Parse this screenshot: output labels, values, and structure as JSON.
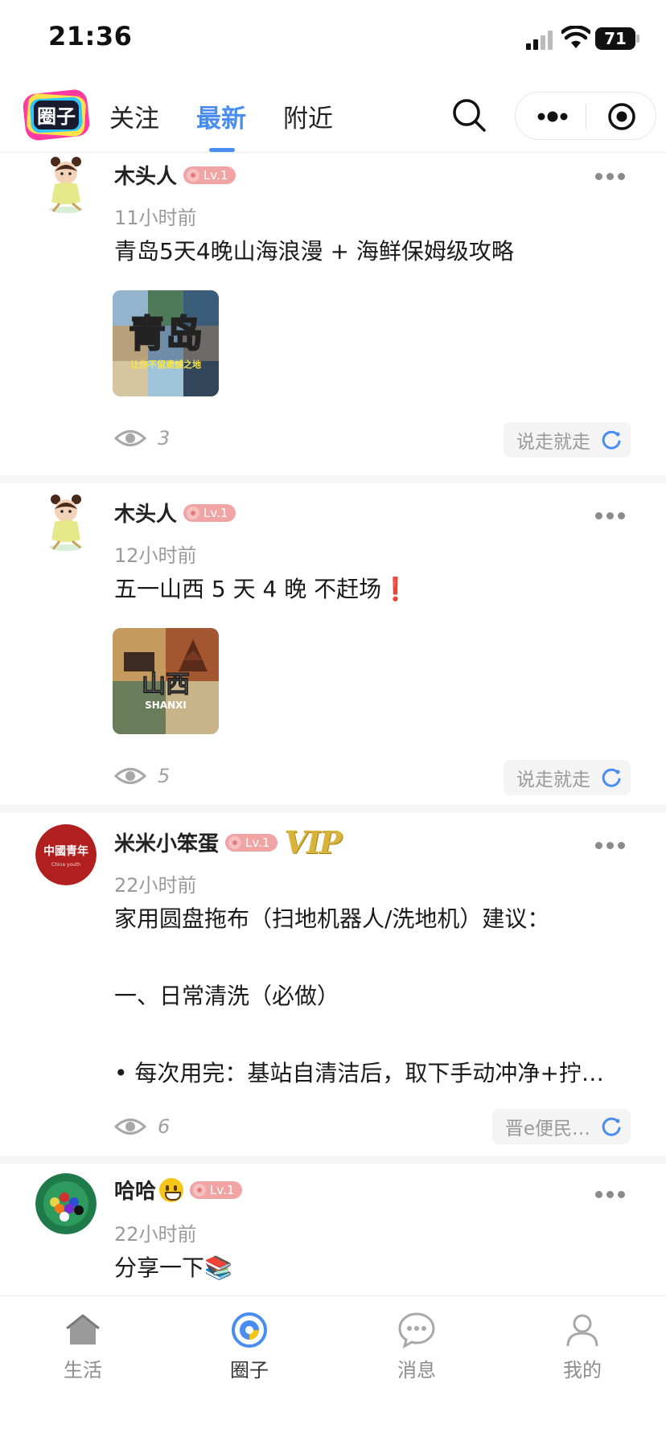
{
  "status_bar": {
    "time": "21:36",
    "battery": "71"
  },
  "header": {
    "logo_text": "圈子",
    "tabs": [
      {
        "label": "关注",
        "active": false
      },
      {
        "label": "最新",
        "active": true
      },
      {
        "label": "附近",
        "active": false
      }
    ]
  },
  "posts": [
    {
      "author": "木头人",
      "level": "Lv.1",
      "time": "11小时前",
      "content": "青岛5天4晚山海浪漫 + 海鲜保姆级攻略",
      "image_title": "青岛",
      "image_caption": "让你不留遗憾之地",
      "views": "3",
      "tag": "说走就走"
    },
    {
      "author": "木头人",
      "level": "Lv.1",
      "time": "12小时前",
      "content": "五一山西 5 天 4 晚 不赶场❗",
      "image_title": "山西",
      "image_caption": "SHANXI",
      "views": "5",
      "tag": "说走就走"
    },
    {
      "author": "米米小笨蛋",
      "level": "Lv.1",
      "vip": "VIP",
      "avatar_text": "中國青年",
      "avatar_subtext": "China youth",
      "time": "22小时前",
      "content_lines": [
        "家用圆盘拖布（扫地机器人/洗地机）建议：",
        "",
        "一、日常清洗（必做）",
        "",
        "• 每次用完：基站自清洁后，取下手动冲净+拧…"
      ],
      "views": "6",
      "tag": "晋e便民…"
    },
    {
      "author": "哈哈",
      "level": "Lv.1",
      "time": "22小时前",
      "content": "分享一下📚"
    }
  ],
  "tabbar": [
    {
      "label": "生活",
      "icon": "home-icon",
      "active": false
    },
    {
      "label": "圈子",
      "icon": "circle-icon",
      "active": true
    },
    {
      "label": "消息",
      "icon": "chat-icon",
      "active": false
    },
    {
      "label": "我的",
      "icon": "user-icon",
      "active": false
    }
  ],
  "colors": {
    "accent": "#4a8df0",
    "level_badge": "#f0a4a4",
    "vip_gold": "#d9b43a"
  }
}
